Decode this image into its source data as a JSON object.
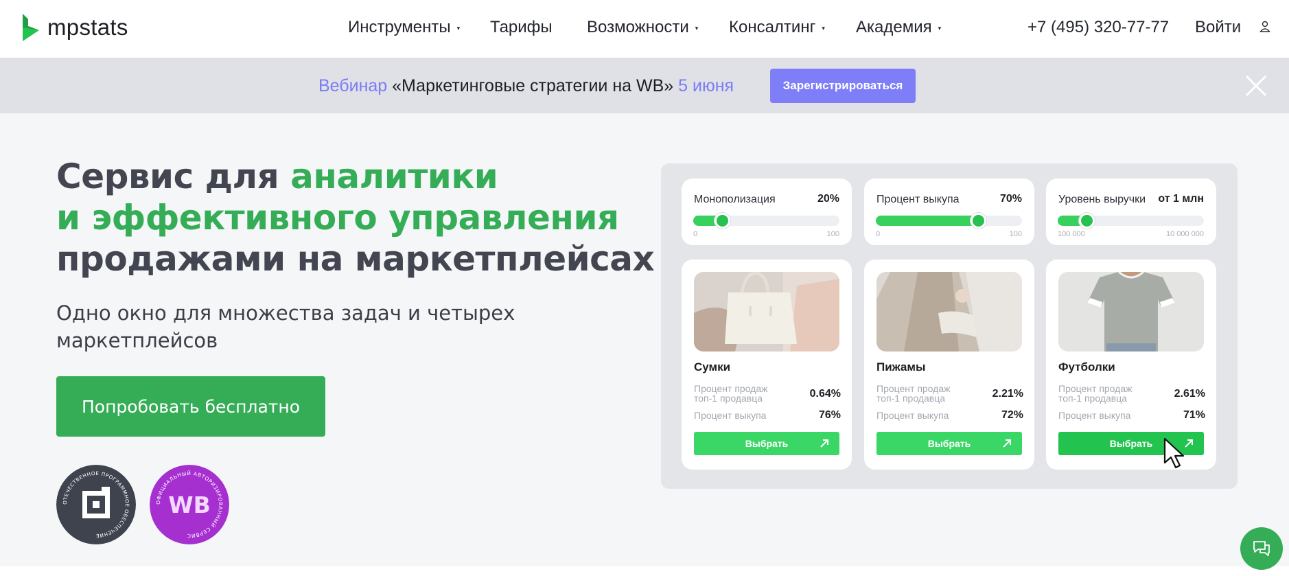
{
  "header": {
    "logo_text": "mpstats",
    "nav": [
      {
        "label": "Инструменты",
        "dropdown": true
      },
      {
        "label": "Тарифы",
        "dropdown": false
      },
      {
        "label": "Возможности",
        "dropdown": true
      },
      {
        "label": "Консалтинг",
        "dropdown": true
      },
      {
        "label": "Академия",
        "dropdown": true
      }
    ],
    "caret": "▾",
    "phone": "+7 (495) 320-77-77",
    "login": "Войти"
  },
  "banner": {
    "word_webinar": "Вебинар",
    "title": "«Маркетинговые стратегии на WB»",
    "date": "5 июня",
    "register_label": "Зарегистрироваться"
  },
  "hero": {
    "title_line1_dark": "Сервис для ",
    "title_line1_green": "аналитики",
    "title_line2_green": "и эффективного управления",
    "title_line3_dark": "продажами на маркетплейсах",
    "subtitle": "Одно окно для множества задач и четырех маркетплейсов",
    "cta_label": "Попробовать бесплатно",
    "badge1_ring": "ОТЕЧЕСТВЕННОЕ ПРОГРАММНОЕ ОБЕСПЕЧЕНИЕ",
    "badge2_center": "WB",
    "badge2_ring": "ОФИЦИАЛЬНЫЙ АВТОРИЗИРОВАННЫЙ СЕРВИС"
  },
  "filters": [
    {
      "label": "Монополизация",
      "value": "20%",
      "level": 0.2,
      "min": "0",
      "max": "100"
    },
    {
      "label": "Процент выкупа",
      "value": "70%",
      "level": 0.7,
      "min": "0",
      "max": "100"
    },
    {
      "label": "Уровень выручки",
      "value": "от 1 млн",
      "level": 0.2,
      "min": "100 000",
      "max": "10 000 000"
    }
  ],
  "products": [
    {
      "name": "Сумки",
      "row1_label": "Процент продаж топ-1 продавца",
      "row1_value": "0.64%",
      "row2_label": "Процент выкупа",
      "row2_value": "76%",
      "button": "Выбрать"
    },
    {
      "name": "Пижамы",
      "row1_label": "Процент продаж топ-1 продавца",
      "row1_value": "2.21%",
      "row2_label": "Процент выкупа",
      "row2_value": "72%",
      "button": "Выбрать"
    },
    {
      "name": "Футболки",
      "row1_label": "Процент продаж топ-1 продавца",
      "row1_value": "2.61%",
      "row2_label": "Процент выкупа",
      "row2_value": "71%",
      "button": "Выбрать"
    }
  ],
  "colors": {
    "brand_green": "#35ad57",
    "slider_green": "#38d15d",
    "webinar_accent": "#7b7cf6",
    "register_button": "#7d7ef8"
  },
  "icons": {
    "user": "user-icon",
    "close": "close-icon",
    "arrow": "arrow-up-right-icon",
    "chat": "chat-icon",
    "cursor": "mouse-cursor-icon"
  }
}
